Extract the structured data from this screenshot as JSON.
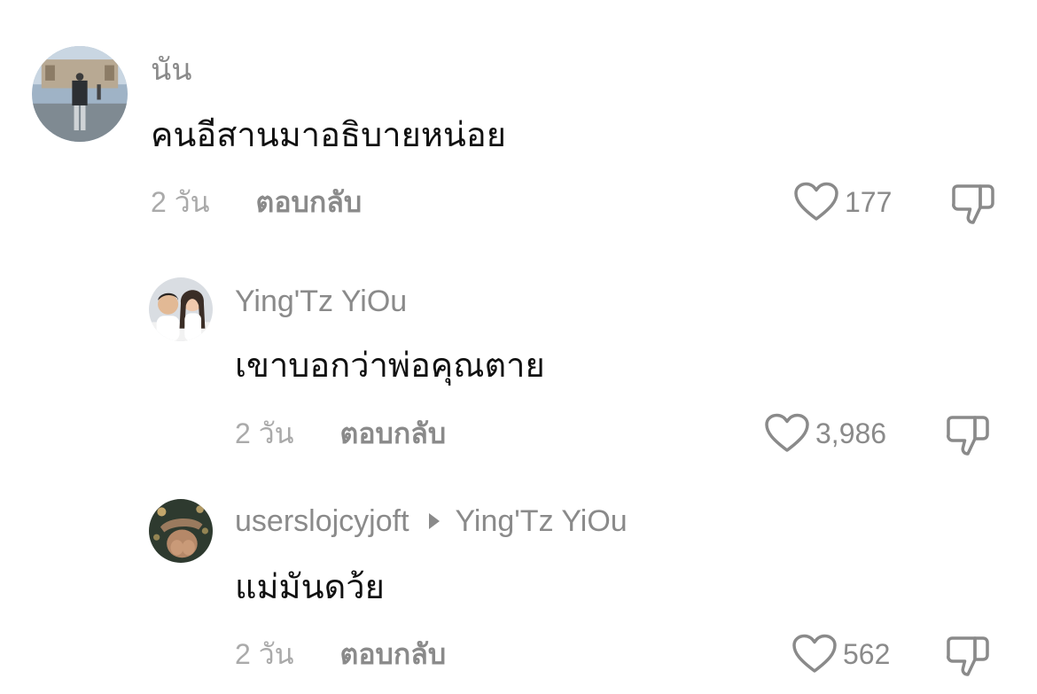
{
  "comments": [
    {
      "username": "นัน",
      "text": "คนอีสานมาอธิบายหน่อย",
      "time": "2 วัน",
      "reply_label": "ตอบกลับ",
      "likes": "177"
    },
    {
      "username": "Ying'Tz YiOu",
      "text": "เขาบอกว่าพ่อคุณตาย",
      "time": "2 วัน",
      "reply_label": "ตอบกลับ",
      "likes": "3,986"
    },
    {
      "username": "userslojcyjoft",
      "reply_to": "Ying'Tz YiOu",
      "text": "แม่มันดว้ย",
      "time": "2 วัน",
      "reply_label": "ตอบกลับ",
      "likes": "562"
    }
  ],
  "icons": {
    "like": "heart-outline-icon",
    "dislike": "thumbs-down-outline-icon",
    "reply_to": "triangle-right-icon"
  },
  "colors": {
    "username": "#8a8a8a",
    "text": "#111111",
    "meta": "#aaaaaa"
  }
}
